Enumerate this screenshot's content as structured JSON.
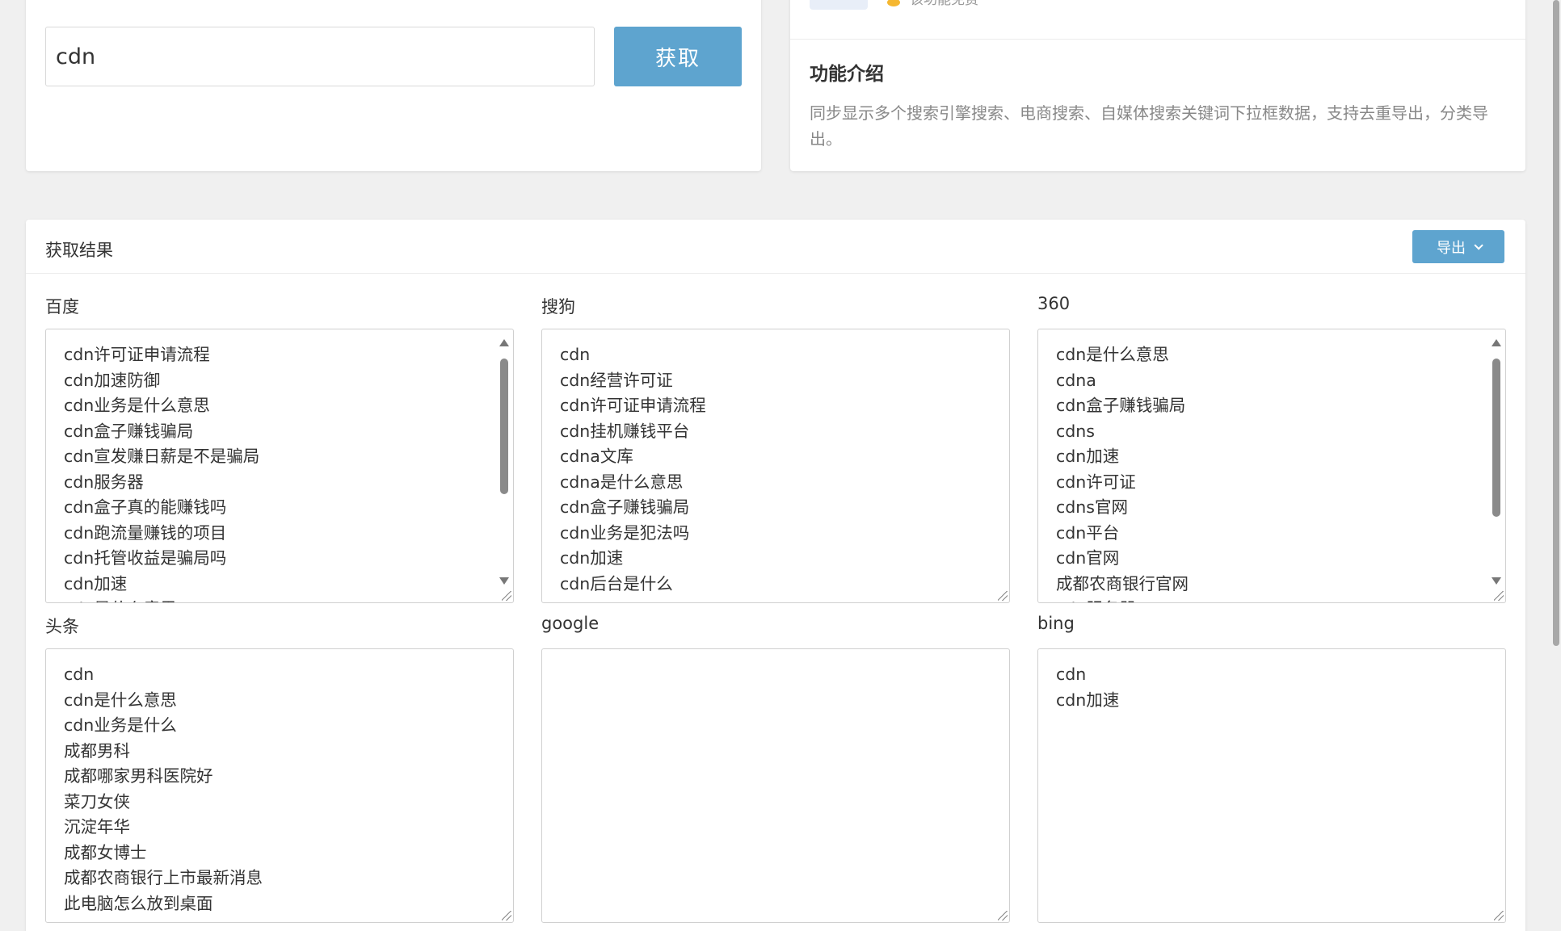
{
  "search": {
    "value": "cdn",
    "button_label": "获取"
  },
  "intro": {
    "free_label": "该功能免费",
    "title": "功能介绍",
    "description": "同步显示多个搜索引擎搜索、电商搜索、自媒体搜索关键词下拉框数据，支持去重导出，分类导出。"
  },
  "results": {
    "title": "获取结果",
    "export_label": "导出",
    "engines": [
      {
        "label": "百度",
        "items": [
          "cdn许可证申请流程",
          "cdn加速防御",
          "cdn业务是什么意思",
          "cdn盒子赚钱骗局",
          "cdn宣发赚日薪是不是骗局",
          "cdn服务器",
          "cdn盒子真的能赚钱吗",
          "cdn跑流量赚钱的项目",
          "cdn托管收益是骗局吗",
          "cdn加速",
          "cdn是什么意思"
        ]
      },
      {
        "label": "搜狗",
        "items": [
          "cdn",
          "cdn经营许可证",
          "cdn许可证申请流程",
          "cdn挂机赚钱平台",
          "cdna文库",
          "cdna是什么意思",
          "cdn盒子赚钱骗局",
          "cdn业务是犯法吗",
          "cdn加速",
          "cdn后台是什么"
        ]
      },
      {
        "label": "360",
        "items": [
          "cdn是什么意思",
          "cdna",
          "cdn盒子赚钱骗局",
          "cdns",
          "cdn加速",
          "cdn许可证",
          "cdns官网",
          "cdn平台",
          "cdn官网",
          "成都农商银行官网",
          "cdn服务器"
        ]
      },
      {
        "label": "头条",
        "items": [
          "cdn",
          "cdn是什么意思",
          "cdn业务是什么",
          "成都男科",
          "成都哪家男科医院好",
          "菜刀女侠",
          "沉淀年华",
          "成都女博士",
          "成都农商银行上市最新消息",
          "此电脑怎么放到桌面"
        ]
      },
      {
        "label": "google",
        "items": []
      },
      {
        "label": "bing",
        "items": [
          "cdn",
          "cdn加速"
        ]
      }
    ]
  }
}
